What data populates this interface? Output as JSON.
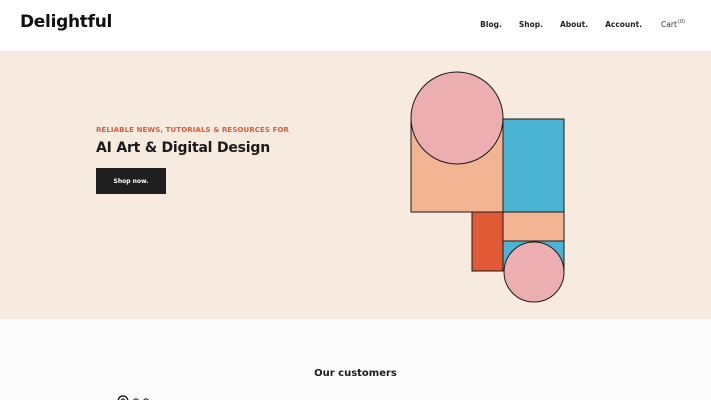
{
  "header": {
    "logo": "Delightful",
    "nav": [
      "Blog.",
      "Shop.",
      "About.",
      "Account."
    ],
    "cart_label": "Cart",
    "cart_count": "(0)"
  },
  "hero": {
    "eyebrow": "RELIABLE NEWS, TUTORIALS & RESOURCES FOR",
    "headline": "AI Art & Digital Design",
    "cta": "Shop now."
  },
  "customers": {
    "title": "Our customers"
  },
  "colors": {
    "hero_bg": "#f7ebe0",
    "accent": "#e25a35",
    "pink": "#ecaeb0",
    "peach": "#f2b493",
    "blue": "#4cb5d4",
    "dark_button": "#1f1f1f"
  }
}
